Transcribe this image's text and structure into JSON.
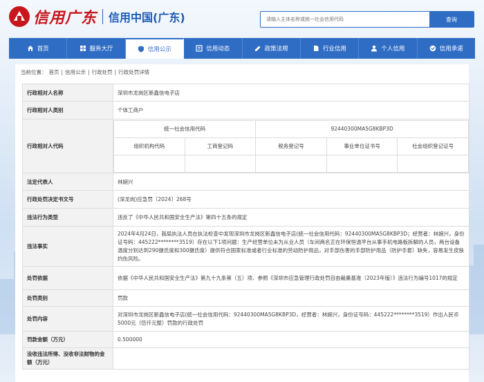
{
  "header": {
    "brand": "信用广东",
    "site_name": "信用中国(广东)",
    "search_placeholder": "请输入主体名称或统一社会信用代码",
    "search_button": "查询"
  },
  "nav": [
    {
      "label": "首页",
      "icon": "home-icon"
    },
    {
      "label": "服务大厅",
      "icon": "grid-icon"
    },
    {
      "label": "信用公示",
      "icon": "shield-icon",
      "active": true
    },
    {
      "label": "信用动态",
      "icon": "news-icon"
    },
    {
      "label": "政策法规",
      "icon": "edit-icon"
    },
    {
      "label": "行业信用",
      "icon": "doc-icon"
    },
    {
      "label": "个人信用",
      "icon": "user-icon"
    },
    {
      "label": "信用承诺",
      "icon": "check-icon"
    }
  ],
  "breadcrumb": {
    "prefix": "当前位置：",
    "items": [
      "首页",
      "信用公示",
      "行政处罚",
      "行政处罚详情"
    ],
    "sep": "|"
  },
  "record": {
    "party_name_label": "行政相对人名称",
    "party_name": "深圳市龙岗区新鑫信电子店",
    "party_type_label": "行政相对人类别",
    "party_type": "个体工商户",
    "party_code_label": "行政相对人代码",
    "code_headers": {
      "uscc": "统一社会信用代码",
      "uscc_value": "92440300MA5G8KBP3D",
      "org": "组织机构代码",
      "biz": "工商登记码",
      "tax": "税务登记号",
      "inst": "事业单位证书号",
      "soc": "社会组织登记证号"
    },
    "rep_label": "法定代表人",
    "rep": "林婉兴",
    "doc_no_label": "行政处罚决定书文号",
    "doc_no": "(深龙岗)应急罚〔2024〕268号",
    "violation_type_label": "违法行为类型",
    "violation_type": "违反了《中华人民共和国安全生产法》第四十五条的规定",
    "facts_label": "违法事实",
    "facts": "2024年4月24日，我局执法人员在执法检查中发现深圳市龙岗区新鑫信电子店(统一社会信用代码：92440300MA5G8KBP3D；经营者：林婉兴，身份证号码：445222********3519）存在以下1项问题：生产经营单位未为从业人员（车间两名正在环保恒温平台从事手机电路板拆解的人员，两台设备温度分别达到290摄氏度和300摄氏度）提供符合国家标准或者行业标准的劳动防护用品，对手部伤害的手部防护用品（防护手套）缺失，容易发生皮肤灼伤风险。",
    "basis_label": "处罚依据",
    "basis": "依据《中华人民共和国安全生产法》第九十九条第（五）项、参照《深圳市应急管理行政处罚自由裁量基准（2023年版）》违法行为编号1017的规定",
    "category_label": "处罚类别",
    "category": "罚款",
    "content_label": "处罚内容",
    "content": "对深圳市龙岗区新鑫信电子店(统一社会信用代码：92440300MA5G8KBP3D，经营者：林婉兴，身份证号码：445222********3519）作出人民币5000元（伍仟元整）罚款的行政处罚",
    "amount_label": "罚款金额（万元）",
    "amount": "0.500000",
    "confiscation_label": "没收违法所得、没收非法财物的金额（万元）"
  }
}
